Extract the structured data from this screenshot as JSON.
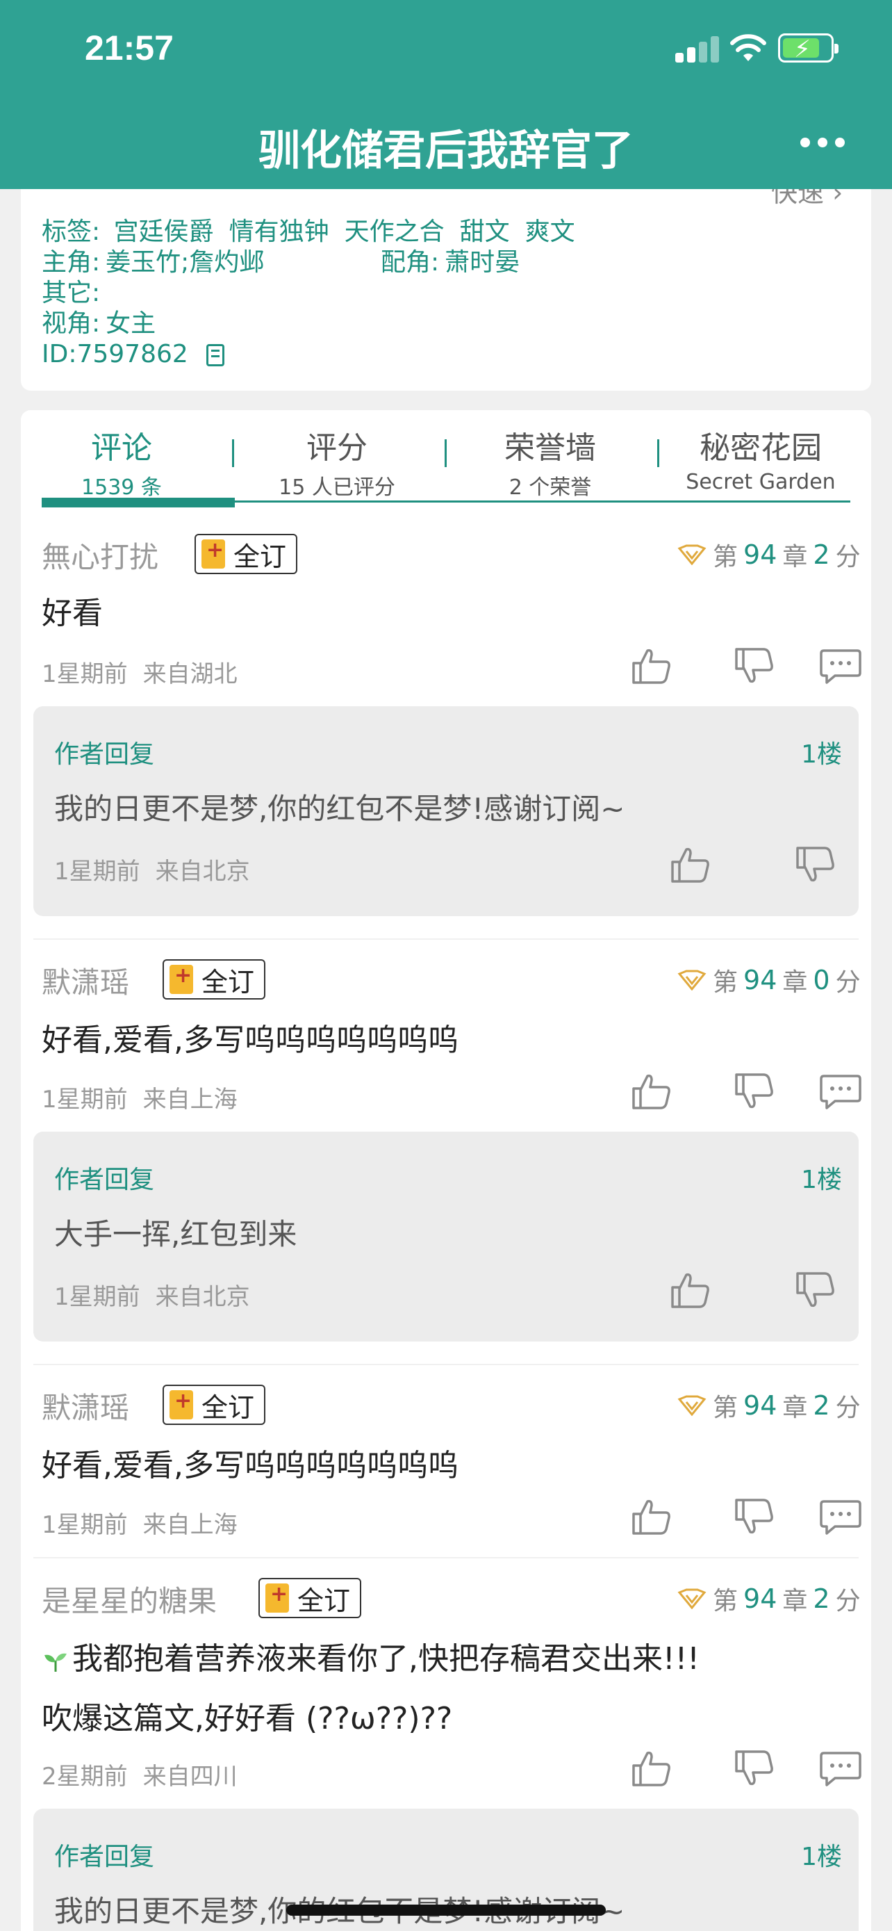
{
  "status": {
    "time": "21:57"
  },
  "header": {
    "title": "驯化储君后我辞官了"
  },
  "info": {
    "cutoff_text": "快速 ›",
    "tags_label": "标签:",
    "tags": [
      "宫廷侯爵",
      "情有独钟",
      "天作之合",
      "甜文",
      "爽文"
    ],
    "lead_label": "主角:",
    "lead": "姜玉竹;詹灼邺",
    "support_label": "配角:",
    "support": "萧时晏",
    "other_label": "其它:",
    "pov_label": "视角:",
    "pov": "女主",
    "id_text": "ID:7597862"
  },
  "tabs": [
    {
      "title": "评论",
      "sub": "1539 条"
    },
    {
      "title": "评分",
      "sub": "15 人已评分"
    },
    {
      "title": "荣誉墙",
      "sub": "2 个荣誉"
    },
    {
      "title": "秘密花园",
      "sub": "Secret Garden"
    }
  ],
  "comments": [
    {
      "user": "無心打扰",
      "badge": "全订",
      "chapter_prefix": "第",
      "chapter": "94",
      "chapter_suffix": "章",
      "score": "2",
      "score_unit": "分",
      "text": "好看",
      "time": "1星期前",
      "location": "来自湖北",
      "reply": {
        "label": "作者回复",
        "floor": "1楼",
        "text": "我的日更不是梦,你的红包不是梦!感谢订阅~",
        "time": "1星期前",
        "location": "来自北京"
      }
    },
    {
      "user": "默潇瑶",
      "badge": "全订",
      "chapter_prefix": "第",
      "chapter": "94",
      "chapter_suffix": "章",
      "score": "0",
      "score_unit": "分",
      "text": "好看,爱看,多写呜呜呜呜呜呜呜",
      "time": "1星期前",
      "location": "来自上海",
      "reply": {
        "label": "作者回复",
        "floor": "1楼",
        "text": "大手一挥,红包到来",
        "time": "1星期前",
        "location": "来自北京"
      }
    },
    {
      "user": "默潇瑶",
      "badge": "全订",
      "chapter_prefix": "第",
      "chapter": "94",
      "chapter_suffix": "章",
      "score": "2",
      "score_unit": "分",
      "text": "好看,爱看,多写呜呜呜呜呜呜呜",
      "time": "1星期前",
      "location": "来自上海"
    },
    {
      "user": "是星星的糖果",
      "badge": "全订",
      "chapter_prefix": "第",
      "chapter": "94",
      "chapter_suffix": "章",
      "score": "2",
      "score_unit": "分",
      "text": "我都抱着营养液来看你了,快把存稿君交出来!!!",
      "text2": "吹爆这篇文,好好看 (??ω??)??",
      "time": "2星期前",
      "location": "来自四川",
      "reply": {
        "label": "作者回复",
        "floor": "1楼",
        "text": "我的日更不是梦,你的红包不是梦!感谢订阅~"
      }
    }
  ],
  "colors": {
    "brand": "#2fa293",
    "accent_text": "#1f9080",
    "badge": "#f5b82e"
  }
}
